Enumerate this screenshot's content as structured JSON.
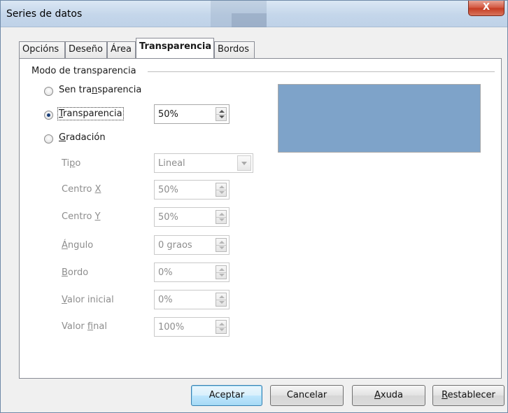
{
  "window": {
    "title": "Series de datos",
    "close_label": "X"
  },
  "tabs": [
    {
      "label": "Opcións",
      "active": false
    },
    {
      "label": "Deseño",
      "active": false
    },
    {
      "label": "Área",
      "active": false
    },
    {
      "label": "Transparencia",
      "active": true
    },
    {
      "label": "Bordos",
      "active": false
    }
  ],
  "group": {
    "title": "Modo de transparencia",
    "options": [
      {
        "label_pre": "Sen tra",
        "label_u": "n",
        "label_post": "sparencia",
        "checked": false
      },
      {
        "label_pre": "",
        "label_u": "T",
        "label_post": "ransparencia",
        "checked": true
      },
      {
        "label_pre": "",
        "label_u": "G",
        "label_post": "radación",
        "checked": false
      }
    ],
    "transparency_value": "50%"
  },
  "gradient": {
    "type": {
      "label_pre": "Ti",
      "label_u": "p",
      "label_post": "o",
      "value": "Lineal"
    },
    "center_x": {
      "label_pre": "Centro ",
      "label_u": "X",
      "label_post": "",
      "value": "50%"
    },
    "center_y": {
      "label_pre": "Centro ",
      "label_u": "Y",
      "label_post": "",
      "value": "50%"
    },
    "angle": {
      "label_pre": "",
      "label_u": "Á",
      "label_post": "ngulo",
      "value": "0 graos"
    },
    "border": {
      "label_pre": "",
      "label_u": "B",
      "label_post": "ordo",
      "value": "0%"
    },
    "start_value": {
      "label_pre": "",
      "label_u": "V",
      "label_post": "alor inicial",
      "value": "0%"
    },
    "end_value": {
      "label_pre": "Valor ",
      "label_u": "f",
      "label_post": "inal",
      "value": "100%"
    }
  },
  "preview": {
    "color": "#7ea3c9"
  },
  "buttons": {
    "ok": "Aceptar",
    "cancel": "Cancelar",
    "help_u": "A",
    "help_rest": "xuda",
    "reset_u": "R",
    "reset_rest": "establecer"
  }
}
